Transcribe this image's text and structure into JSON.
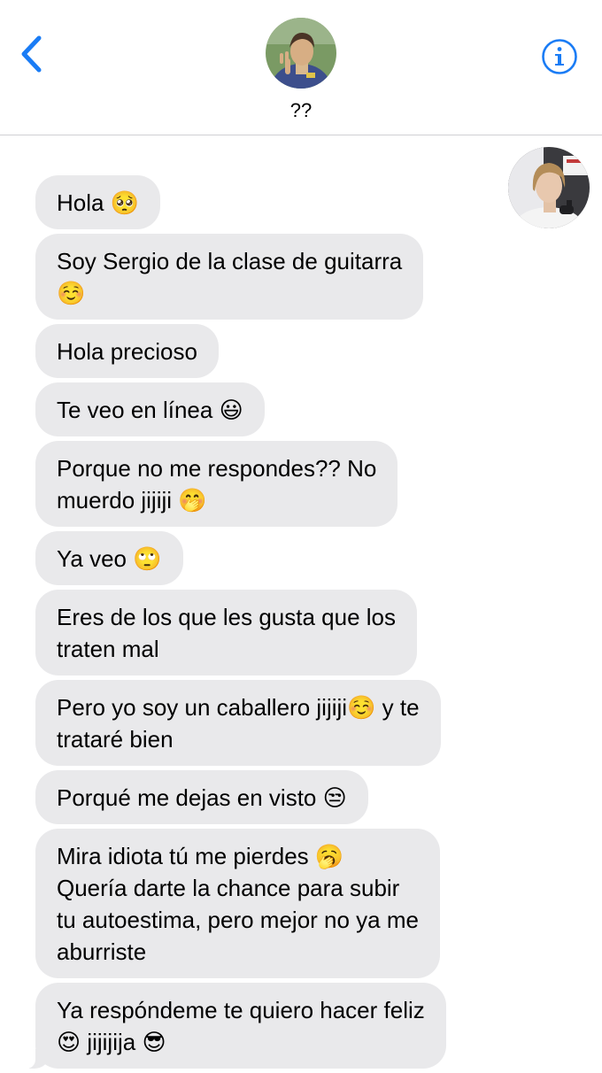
{
  "header": {
    "contact_name": "??",
    "back_icon": "chevron-left-icon",
    "info_icon": "info-icon",
    "accent_color": "#1a7cf5"
  },
  "conversation": {
    "bubble_color": "#e9e9eb",
    "messages": [
      {
        "text": "Hola 🥺"
      },
      {
        "text": "Soy Sergio de la clase de guitarra\n☺️"
      },
      {
        "text": "Hola precioso"
      },
      {
        "text": "Te veo en línea 😃"
      },
      {
        "text": "Porque no me respondes?? No\nmuerdo jijiji 🤭"
      },
      {
        "text": "Ya veo 🙄"
      },
      {
        "text": "Eres de los que les gusta que los\ntraten mal"
      },
      {
        "text": "Pero yo soy un caballero jijiji☺️ y te\ntrataré bien"
      },
      {
        "text": "Porqué me dejas en visto 😒"
      },
      {
        "text": "Mira idiota tú me pierdes 🥱\nQuería darte la chance para subir\ntu autoestima, pero mejor no ya me\naburriste"
      },
      {
        "text": "Ya respóndeme te quiero hacer feliz\n😍 jijijija 😎"
      }
    ]
  }
}
